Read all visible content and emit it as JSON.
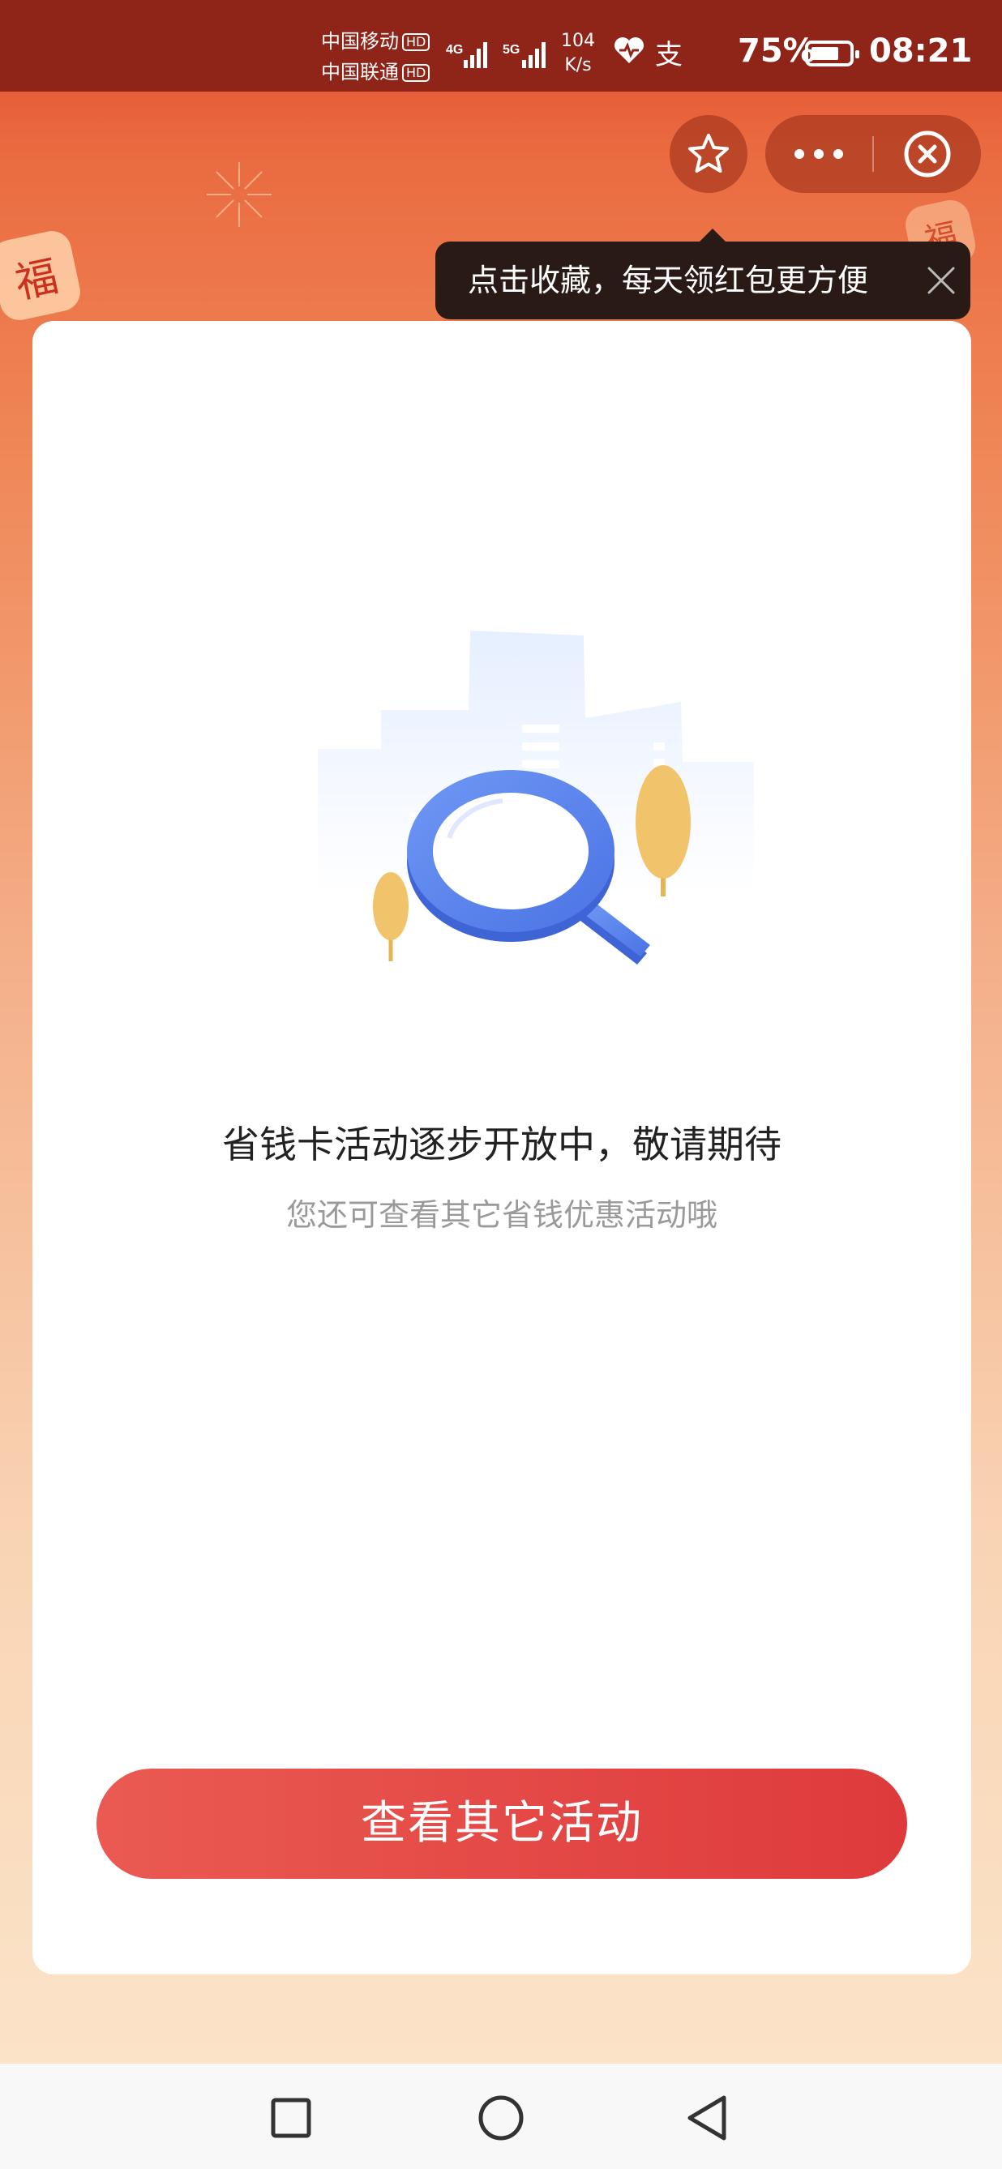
{
  "status_bar": {
    "carrier1": "中国移动",
    "carrier2": "中国联通",
    "hd_badge": "HD",
    "net1": "4G",
    "net2": "5G",
    "speed_value": "104",
    "speed_unit": "K/s",
    "alipay_glyph": "支",
    "battery": "75%",
    "battery_level": 0.75,
    "time": "08:21"
  },
  "header": {
    "favorite_icon": "star-icon",
    "more_icon": "more-dots-icon",
    "close_icon": "close-circle-icon"
  },
  "decor": {
    "fu_char": "福"
  },
  "tooltip": {
    "text": "点击收藏，每天领红包更方便",
    "close_icon": "close-icon"
  },
  "content": {
    "illustration": "search-empty-illustration",
    "title": "省钱卡活动逐步开放中，敬请期待",
    "subtitle": "您还可查看其它省钱优惠活动哦",
    "button_label": "查看其它活动"
  },
  "colors": {
    "status_bar_bg": "#8f2418",
    "button_start": "#ea5a52",
    "button_end": "#de3a3c",
    "magnifier": "#5b86ee",
    "tree": "#f1c36a"
  },
  "nav_bar": {
    "recents_icon": "square-icon",
    "home_icon": "circle-icon",
    "back_icon": "triangle-back-icon"
  }
}
